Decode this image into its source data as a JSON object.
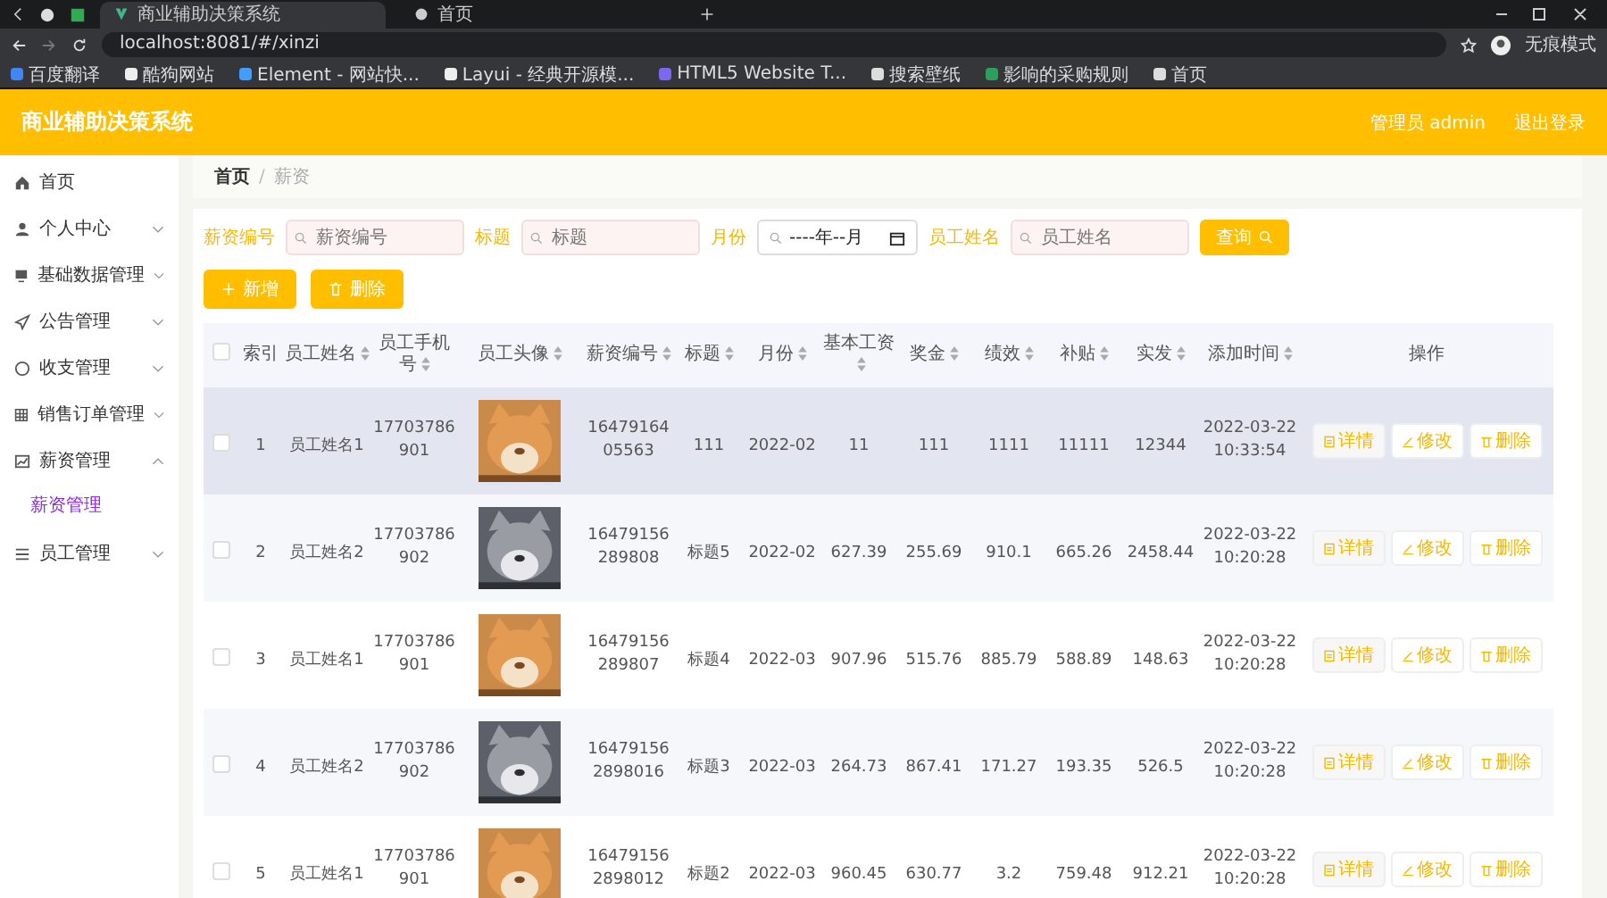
{
  "browser": {
    "tabs": [
      {
        "title": "商业辅助决策系统",
        "selected": true
      },
      {
        "title": "首页",
        "selected": false
      }
    ],
    "address": "localhost:8081/#/xinzi",
    "profile": "无痕模式",
    "bookmarks": [
      {
        "label": "百度翻译"
      },
      {
        "label": "酷狗网站"
      },
      {
        "label": "Element - 网站快..."
      },
      {
        "label": "Layui - 经典开源模..."
      },
      {
        "label": "HTML5 Website T..."
      },
      {
        "label": "搜索壁纸"
      },
      {
        "label": "影响的采购规则"
      },
      {
        "label": "首页"
      }
    ]
  },
  "header": {
    "title": "商业辅助决策系统",
    "user": "管理员 admin",
    "logout": "退出登录"
  },
  "sidebar": {
    "items": [
      {
        "label": "首页"
      },
      {
        "label": "个人中心",
        "expanded": false
      },
      {
        "label": "基础数据管理",
        "expanded": false
      },
      {
        "label": "公告管理",
        "expanded": false
      },
      {
        "label": "收支管理",
        "expanded": false
      },
      {
        "label": "销售订单管理",
        "expanded": false
      },
      {
        "label": "薪资管理",
        "expanded": true,
        "children": [
          {
            "label": "薪资管理",
            "selected": true
          }
        ]
      },
      {
        "label": "员工管理",
        "expanded": false
      }
    ]
  },
  "breadcrumb": [
    {
      "label": "首页"
    },
    {
      "label": "薪资"
    }
  ],
  "breadcrumb_separator": "/",
  "filters": [
    {
      "label": "薪资编号",
      "kind": "text",
      "placeholder": "薪资编号"
    },
    {
      "label": "标题",
      "kind": "text",
      "placeholder": "标题"
    },
    {
      "label": "月份",
      "kind": "month",
      "value": "----年--月"
    },
    {
      "label": "员工姓名",
      "kind": "text",
      "placeholder": "员工姓名"
    }
  ],
  "search_button": "查询",
  "actions": [
    {
      "label": "新增",
      "kind": "add"
    },
    {
      "label": "删除",
      "kind": "delete"
    }
  ],
  "table": {
    "header_checked": false,
    "columns": [
      {
        "label": "索引",
        "sortable": false
      },
      {
        "label": "员工姓名",
        "sortable": true
      },
      {
        "label": "员工手机号",
        "sortable": true
      },
      {
        "label": "员工头像",
        "sortable": true
      },
      {
        "label": "薪资编号",
        "sortable": true
      },
      {
        "label": "标题",
        "sortable": true
      },
      {
        "label": "月份",
        "sortable": true
      },
      {
        "label": "基本工资",
        "sortable": true
      },
      {
        "label": "奖金",
        "sortable": true
      },
      {
        "label": "绩效",
        "sortable": true
      },
      {
        "label": "补贴",
        "sortable": true
      },
      {
        "label": "实发",
        "sortable": true
      },
      {
        "label": "添加时间",
        "sortable": true
      },
      {
        "label": "操作",
        "sortable": false
      }
    ],
    "rows": [
      {
        "checked": false,
        "hovered": true,
        "index": "1",
        "name": "员工姓名1",
        "phone": "17703786901",
        "avatar": {
          "kind": "picture"
        },
        "salary_no": "1647916405563",
        "title": "111",
        "month": "2022-02",
        "base": "11",
        "bonus": "111",
        "performance": "1111",
        "subsidy": "11111",
        "net": "12344",
        "added": "2022-03-22 10:33:54",
        "buttons": [
          {
            "kind": "detail",
            "label": "详情"
          },
          {
            "kind": "edit",
            "label": "修改"
          },
          {
            "kind": "delete",
            "label": "删除"
          }
        ]
      },
      {
        "checked": false,
        "hovered": false,
        "index": "2",
        "name": "员工姓名2",
        "phone": "17703786902",
        "avatar": {
          "kind": "picture"
        },
        "salary_no": "16479156289808",
        "title": "标题5",
        "month": "2022-02",
        "base": "627.39",
        "bonus": "255.69",
        "performance": "910.1",
        "subsidy": "665.26",
        "net": "2458.44",
        "added": "2022-03-22 10:20:28",
        "buttons": [
          {
            "kind": "detail",
            "label": "详情"
          },
          {
            "kind": "edit",
            "label": "修改"
          },
          {
            "kind": "delete",
            "label": "删除"
          }
        ]
      },
      {
        "checked": false,
        "hovered": false,
        "index": "3",
        "name": "员工姓名1",
        "phone": "17703786901",
        "avatar": {
          "kind": "picture"
        },
        "salary_no": "16479156289807",
        "title": "标题4",
        "month": "2022-03",
        "base": "907.96",
        "bonus": "515.76",
        "performance": "885.79",
        "subsidy": "588.89",
        "net": "148.63",
        "added": "2022-03-22 10:20:28",
        "buttons": [
          {
            "kind": "detail",
            "label": "详情"
          },
          {
            "kind": "edit",
            "label": "修改"
          },
          {
            "kind": "delete",
            "label": "删除"
          }
        ]
      },
      {
        "checked": false,
        "hovered": false,
        "index": "4",
        "name": "员工姓名2",
        "phone": "17703786902",
        "avatar": {
          "kind": "picture"
        },
        "salary_no": "164791562898016",
        "title": "标题3",
        "month": "2022-03",
        "base": "264.73",
        "bonus": "867.41",
        "performance": "171.27",
        "subsidy": "193.35",
        "net": "526.5",
        "added": "2022-03-22 10:20:28",
        "buttons": [
          {
            "kind": "detail",
            "label": "详情"
          },
          {
            "kind": "edit",
            "label": "修改"
          },
          {
            "kind": "delete",
            "label": "删除"
          }
        ]
      },
      {
        "checked": false,
        "hovered": false,
        "index": "5",
        "name": "员工姓名1",
        "phone": "17703786901",
        "avatar": {
          "kind": "picture"
        },
        "salary_no": "164791562898012",
        "title": "标题2",
        "month": "2022-03",
        "base": "960.45",
        "bonus": "630.77",
        "performance": "3.2",
        "subsidy": "759.48",
        "net": "912.21",
        "added": "2022-03-22 10:20:28",
        "buttons": [
          {
            "kind": "detail",
            "label": "详情"
          },
          {
            "kind": "edit",
            "label": "修改"
          },
          {
            "kind": "delete",
            "label": "删除"
          }
        ]
      }
    ]
  }
}
